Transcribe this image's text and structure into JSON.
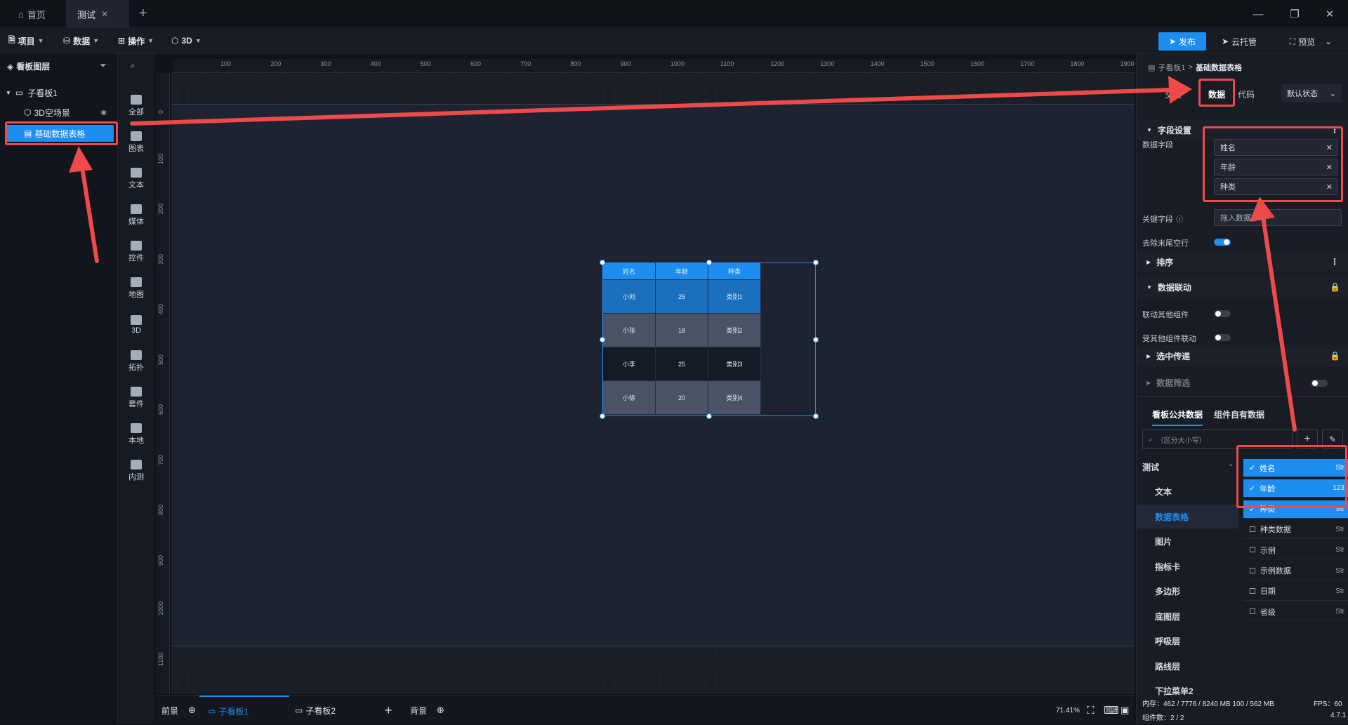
{
  "tabs": [
    {
      "label": "首页"
    },
    {
      "label": "测试"
    }
  ],
  "menubar": {
    "items": [
      "项目",
      "数据",
      "操作",
      "3D"
    ],
    "publish": "发布",
    "cloud": "云托管",
    "preview": "预览"
  },
  "layers": {
    "title": "看板图层",
    "items": [
      {
        "label": "子看板1"
      },
      {
        "label": "3D空场景"
      },
      {
        "label": "基础数据表格"
      }
    ]
  },
  "toolbar": {
    "items": [
      "全部",
      "图表",
      "文本",
      "媒体",
      "控件",
      "地图",
      "3D",
      "拓扑",
      "套件",
      "本地",
      "内测"
    ]
  },
  "ruler": {
    "top": [
      "100",
      "200",
      "300",
      "400",
      "500",
      "600",
      "700",
      "800",
      "900",
      "1000",
      "1100",
      "1200",
      "1300",
      "1400",
      "1500",
      "1600",
      "1700",
      "1800",
      "1900"
    ],
    "left": [
      "0",
      "100",
      "200",
      "300",
      "400",
      "500",
      "600",
      "700",
      "800",
      "900",
      "1000",
      "1100"
    ]
  },
  "table": {
    "headers": [
      "姓名",
      "年龄",
      "种类"
    ],
    "rows": [
      [
        "小刘",
        "25",
        "类别1"
      ],
      [
        "小张",
        "18",
        "类别2"
      ],
      [
        "小李",
        "25",
        "类别3"
      ],
      [
        "小徐",
        "20",
        "类别4"
      ]
    ]
  },
  "bottom": {
    "foreground": "前景",
    "board1": "子看板1",
    "board2": "子看板2",
    "background": "背景",
    "zoom": "71.41%"
  },
  "panel": {
    "breadcrumb_parent": "子看板1",
    "breadcrumb_sep": ">",
    "breadcrumb_current": "基础数据表格",
    "tab_partial": "交互",
    "tab_data": "数据",
    "tab_code": "代码",
    "state": "默认状态",
    "sec_fields": "字段设置",
    "data_fields_label": "数据字段",
    "fields": [
      "姓名",
      "年龄",
      "种类"
    ],
    "key_field_label": "关键字段",
    "key_field_placeholder": "拖入数据字段",
    "trim_label": "去除末尾空行",
    "trim_on": true,
    "sec_sort": "排序",
    "sec_link": "数据联动",
    "link_other": "联动其他组件",
    "linked_by": "受其他组件联动",
    "sec_pass": "选中传递",
    "sec_filter": "数据筛选",
    "tab_public": "看板公共数据",
    "tab_own": "组件自有数据",
    "search_placeholder": "（区分大小写）",
    "datasets": [
      "测试",
      "文本",
      "数据表格",
      "图片",
      "指标卡",
      "多边形",
      "底图层",
      "呼吸层",
      "路线层",
      "下拉菜单2"
    ],
    "field_list": [
      {
        "name": "姓名",
        "type": "Str",
        "checked": true
      },
      {
        "name": "年龄",
        "type": "123",
        "checked": true
      },
      {
        "name": "种类",
        "type": "Str",
        "checked": true
      },
      {
        "name": "种类数据",
        "type": "Str",
        "checked": false
      },
      {
        "name": "示例",
        "type": "Str",
        "checked": false
      },
      {
        "name": "示例数据",
        "type": "Str",
        "checked": false
      },
      {
        "name": "日期",
        "type": "Str",
        "checked": false
      },
      {
        "name": "省级",
        "type": "Str",
        "checked": false
      }
    ],
    "mem": "内存：462 / 7776 / 8240 MB  100 / 562 MB",
    "fps": "FPS：60",
    "count": "组件数：2 / 2",
    "version": "4.7.1"
  },
  "colors": {
    "accent": "#1d8ef0",
    "annotation": "#ee4a4a"
  }
}
